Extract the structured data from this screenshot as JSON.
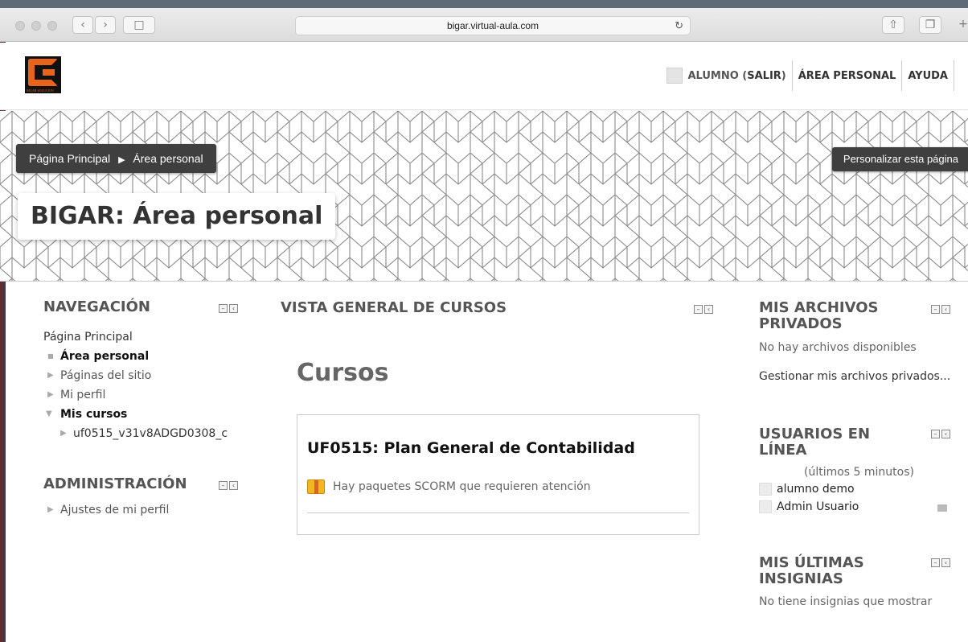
{
  "browser": {
    "url": "bigar.virtual-aula.com"
  },
  "header": {
    "logo_text": "BIGAR SOLUCION",
    "user_label": "ALUMNO",
    "logout_label": "SALIR",
    "personal_area": "ÁREA PERSONAL",
    "help": "AYUDA"
  },
  "banner": {
    "breadcrumb_home": "Página Principal",
    "breadcrumb_current": "Área personal",
    "customise_button": "Personalizar esta página",
    "page_title": "BIGAR: Área personal"
  },
  "navigation": {
    "title": "NAVEGACIÓN",
    "home": "Página Principal",
    "items": [
      {
        "label": "Área personal"
      },
      {
        "label": "Páginas del sitio"
      },
      {
        "label": "Mi perfil"
      },
      {
        "label": "Mis cursos"
      },
      {
        "label": "uf0515_v31v8ADGD0308_c"
      }
    ]
  },
  "administration": {
    "title": "ADMINISTRACIÓN",
    "items": [
      {
        "label": "Ajustes de mi perfil"
      }
    ]
  },
  "overview": {
    "title": "VISTA GENERAL DE CURSOS",
    "heading": "Cursos",
    "course_title": "UF0515: Plan General de Contabilidad",
    "notice": "Hay paquetes SCORM que requieren atención"
  },
  "private_files": {
    "title": "MIS ARCHIVOS PRIVADOS",
    "empty": "No hay archivos disponibles",
    "manage": "Gestionar mis archivos privados..."
  },
  "online_users": {
    "title": "USUARIOS EN LÍNEA",
    "period": "(últimos 5 minutos)",
    "users": [
      "alumno demo",
      "Admin Usuario"
    ]
  },
  "badges": {
    "title": "MIS ÚLTIMAS INSIGNIAS",
    "empty": "No tiene insignias que mostrar"
  },
  "colors": {
    "accent": "#e8641b",
    "dark_bar": "#3f3f3f"
  }
}
